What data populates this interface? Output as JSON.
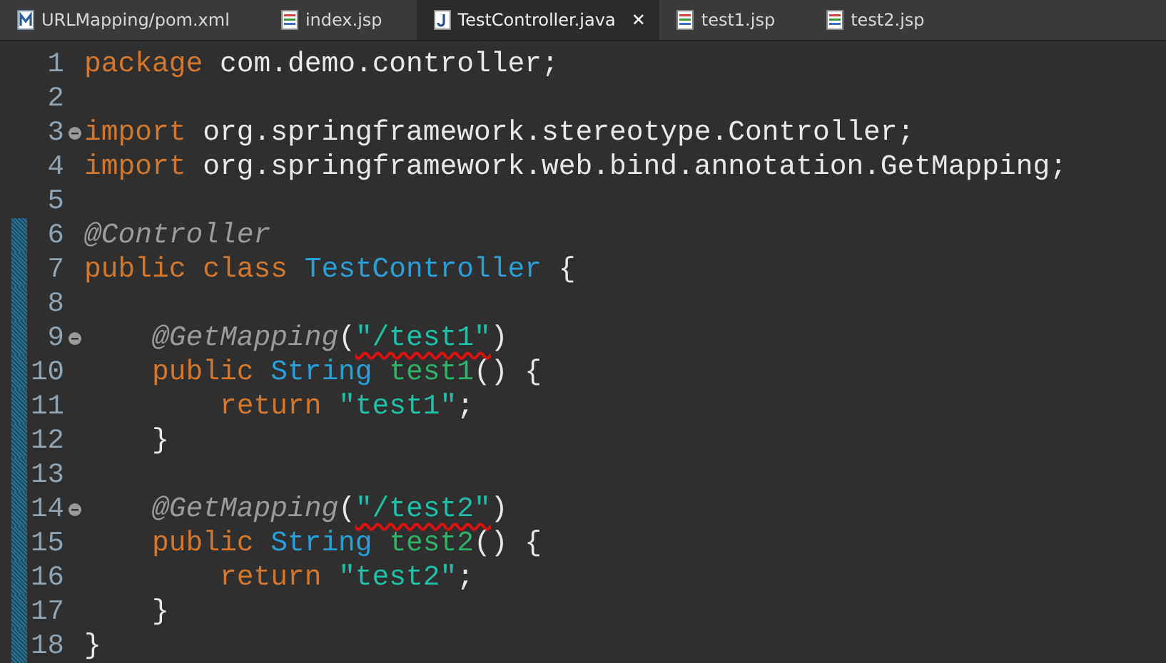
{
  "tabs": [
    {
      "label": "URLMapping/pom.xml",
      "kind": "maven",
      "selected": false,
      "closable": false
    },
    {
      "label": "index.jsp",
      "kind": "jsp",
      "selected": false,
      "closable": false
    },
    {
      "label": "TestController.java",
      "kind": "java",
      "selected": true,
      "closable": true
    },
    {
      "label": "test1.jsp",
      "kind": "jsp",
      "selected": false,
      "closable": false
    },
    {
      "label": "test2.jsp",
      "kind": "jsp",
      "selected": false,
      "closable": false
    }
  ],
  "close_glyph": "✕",
  "lines": [
    {
      "number": "1",
      "fold": false,
      "changed": false,
      "tokens": [
        {
          "text": "package",
          "kind": "keyword",
          "underlined": false
        },
        {
          "text": " com.demo.controller;",
          "kind": "plain",
          "underlined": false
        }
      ]
    },
    {
      "number": "2",
      "fold": false,
      "changed": false
    },
    {
      "number": "3",
      "fold": true,
      "changed": false,
      "tokens": [
        {
          "text": "import",
          "kind": "keyword",
          "underlined": false
        },
        {
          "text": " org.springframework.stereotype.Controller;",
          "kind": "plain",
          "underlined": false
        }
      ]
    },
    {
      "number": "4",
      "fold": false,
      "changed": false,
      "tokens": [
        {
          "text": "import",
          "kind": "keyword",
          "underlined": false
        },
        {
          "text": " org.springframework.web.bind.annotation.GetMapping;",
          "kind": "plain",
          "underlined": false
        }
      ]
    },
    {
      "number": "5",
      "fold": false,
      "changed": false
    },
    {
      "number": "6",
      "fold": false,
      "changed": true,
      "tokens": [
        {
          "text": "@Controller",
          "kind": "annotation",
          "underlined": false
        }
      ]
    },
    {
      "number": "7",
      "fold": false,
      "changed": true,
      "tokens": [
        {
          "text": "public class ",
          "kind": "keyword",
          "underlined": false
        },
        {
          "text": "TestController",
          "kind": "type",
          "underlined": false
        },
        {
          "text": " {",
          "kind": "plain",
          "underlined": false
        }
      ]
    },
    {
      "number": "8",
      "fold": false,
      "changed": true
    },
    {
      "number": "9",
      "fold": true,
      "changed": true,
      "tokens": [
        {
          "text": "    @GetMapping",
          "kind": "annotation",
          "underlined": false
        },
        {
          "text": "(",
          "kind": "plain",
          "underlined": false
        },
        {
          "text": "\"/test1\"",
          "kind": "string",
          "underlined": true
        },
        {
          "text": ")",
          "kind": "plain",
          "underlined": false
        }
      ]
    },
    {
      "number": "10",
      "fold": false,
      "changed": true,
      "tokens": [
        {
          "text": "    public ",
          "kind": "keyword",
          "underlined": false
        },
        {
          "text": "String ",
          "kind": "type",
          "underlined": false
        },
        {
          "text": "test1",
          "kind": "method",
          "underlined": false
        },
        {
          "text": "() {",
          "kind": "plain",
          "underlined": false
        }
      ]
    },
    {
      "number": "11",
      "fold": false,
      "changed": true,
      "tokens": [
        {
          "text": "        return ",
          "kind": "keyword",
          "underlined": false
        },
        {
          "text": "\"test1\"",
          "kind": "string",
          "underlined": false
        },
        {
          "text": ";",
          "kind": "plain",
          "underlined": false
        }
      ]
    },
    {
      "number": "12",
      "fold": false,
      "changed": true,
      "tokens": [
        {
          "text": "    }",
          "kind": "plain",
          "underlined": false
        }
      ]
    },
    {
      "number": "13",
      "fold": false,
      "changed": true
    },
    {
      "number": "14",
      "fold": true,
      "changed": true,
      "tokens": [
        {
          "text": "    @GetMapping",
          "kind": "annotation",
          "underlined": false
        },
        {
          "text": "(",
          "kind": "plain",
          "underlined": false
        },
        {
          "text": "\"/test2\"",
          "kind": "string",
          "underlined": true
        },
        {
          "text": ")",
          "kind": "plain",
          "underlined": false
        }
      ]
    },
    {
      "number": "15",
      "fold": false,
      "changed": true,
      "tokens": [
        {
          "text": "    public ",
          "kind": "keyword",
          "underlined": false
        },
        {
          "text": "String ",
          "kind": "type",
          "underlined": false
        },
        {
          "text": "test2",
          "kind": "method",
          "underlined": false
        },
        {
          "text": "() {",
          "kind": "plain",
          "underlined": false
        }
      ]
    },
    {
      "number": "16",
      "fold": false,
      "changed": true,
      "tokens": [
        {
          "text": "        return ",
          "kind": "keyword",
          "underlined": false
        },
        {
          "text": "\"test2\"",
          "kind": "string",
          "underlined": false
        },
        {
          "text": ";",
          "kind": "plain",
          "underlined": false
        }
      ]
    },
    {
      "number": "17",
      "fold": false,
      "changed": true,
      "tokens": [
        {
          "text": "    }",
          "kind": "plain",
          "underlined": false
        }
      ]
    },
    {
      "number": "18",
      "fold": false,
      "changed": true,
      "tokens": [
        {
          "text": "}",
          "kind": "plain",
          "underlined": false
        }
      ]
    }
  ]
}
